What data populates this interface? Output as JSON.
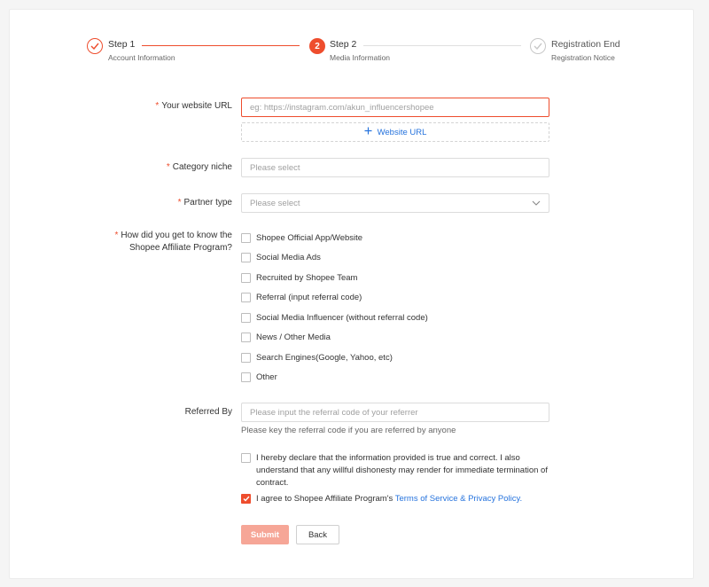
{
  "stepper": {
    "steps": [
      {
        "title": "Step 1",
        "desc": "Account Information",
        "state": "done"
      },
      {
        "title": "Step 2",
        "desc": "Media Information",
        "state": "active",
        "number": "2"
      },
      {
        "title": "Registration End",
        "desc": "Registration Notice",
        "state": "pending"
      }
    ]
  },
  "form": {
    "website": {
      "label": "Your website URL",
      "placeholder": "eg: https://instagram.com/akun_influencershopee",
      "add_label": "Website URL"
    },
    "category": {
      "label": "Category niche",
      "placeholder": "Please select"
    },
    "partner": {
      "label": "Partner type",
      "placeholder": "Please select"
    },
    "source": {
      "label_line1": "How did you get to know the",
      "label_line2": "Shopee Affiliate Program?",
      "options": [
        "Shopee Official App/Website",
        "Social Media Ads",
        "Recruited by Shopee Team",
        "Referral (input referral code)",
        "Social Media Influencer (without referral code)",
        "News / Other Media",
        "Search Engines(Google, Yahoo, etc)",
        "Other"
      ]
    },
    "referred": {
      "label": "Referred By",
      "placeholder": "Please input the referral code of your referrer",
      "hint": "Please key the referral code if you are referred by anyone"
    },
    "declaration": {
      "line1": "I hereby declare that the information provided is true and correct. I also",
      "line2": "understand that any willful dishonesty may render for immediate termination of",
      "line3": "contract.",
      "checked": false
    },
    "agree": {
      "text": "I agree to Shopee Affiliate Program's ",
      "link": "Terms of Service & Privacy Policy.",
      "checked": true
    },
    "submit_label": "Submit",
    "back_label": "Back"
  },
  "colors": {
    "accent": "#ee4d2d",
    "link": "#2673dd",
    "submit_disabled": "#f6a697"
  }
}
